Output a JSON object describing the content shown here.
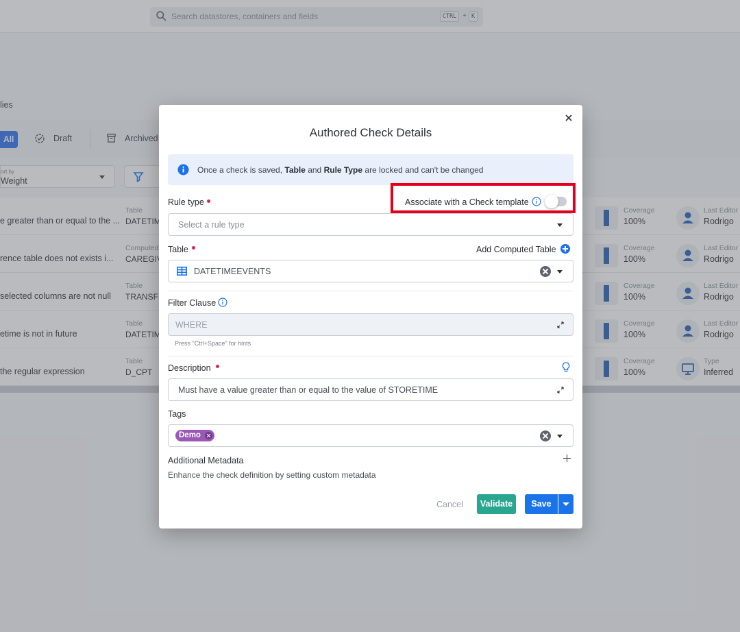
{
  "topbar": {
    "search_placeholder": "Search datastores, containers and fields",
    "shortcut_ctrl": "CTRL",
    "shortcut_plus": "+",
    "shortcut_key": "K"
  },
  "page": {
    "crumb": "lies",
    "tabs": [
      {
        "label": "All"
      },
      {
        "label": "Draft"
      },
      {
        "label": "Archived"
      }
    ],
    "sort_label": "ort by",
    "sort_value": "Weight"
  },
  "rows": [
    {
      "name": "e greater than or equal to the ...",
      "type_label": "Table",
      "type_value": "DATETIM",
      "cov_label": "Coverage",
      "cov_value": "100%",
      "ed_label": "Last Editor",
      "ed_value": "Rodrigo",
      "icon": "user-icon"
    },
    {
      "name": "rence table does not exists i...",
      "type_label": "Computed",
      "type_value": "CAREGIV",
      "cov_label": "Coverage",
      "cov_value": "100%",
      "ed_label": "Last Editor",
      "ed_value": "Rodrigo",
      "icon": "user-icon"
    },
    {
      "name": "selected columns are not null",
      "type_label": "Table",
      "type_value": "TRANSFE",
      "cov_label": "Coverage",
      "cov_value": "100%",
      "ed_label": "Last Editor",
      "ed_value": "Rodrigo",
      "icon": "user-icon"
    },
    {
      "name": "etime is not in future",
      "type_label": "Table",
      "type_value": "DATETIM",
      "cov_label": "Coverage",
      "cov_value": "100%",
      "ed_label": "Last Editor",
      "ed_value": "Rodrigo",
      "icon": "user-icon"
    },
    {
      "name": "the regular expression",
      "type_label": "Table",
      "type_value": "D_CPT",
      "cov_label": "Coverage",
      "cov_value": "100%",
      "ed_label": "Type",
      "ed_value": "Inferred",
      "icon": "monitor-icon"
    }
  ],
  "modal": {
    "title": "Authored Check Details",
    "info_prefix": "Once a check is saved,",
    "info_table": "Table",
    "info_and": "and",
    "info_rule_type": "Rule Type",
    "info_suffix": "are locked and can't be changed",
    "rule_type_label": "Rule type",
    "associate_label": "Associate with a Check template",
    "associate_enabled": false,
    "rule_type_placeholder": "Select a rule type",
    "table_label": "Table",
    "add_computed_label": "Add Computed Table",
    "table_value": "DATETIMEEVENTS",
    "filter_label": "Filter Clause",
    "filter_placeholder": "WHERE",
    "filter_hint": "Press \"Ctrl+Space\" for hints",
    "description_label": "Description",
    "description_value": "Must have a value greater than or equal to the value of STORETIME",
    "tags_label": "Tags",
    "tags": [
      "Demo"
    ],
    "metadata_label": "Additional Metadata",
    "metadata_desc": "Enhance the check definition by setting custom metadata",
    "cancel_label": "Cancel",
    "validate_label": "Validate",
    "save_label": "Save"
  },
  "colors": {
    "primary": "#1a73e8",
    "validate": "#2aa58f",
    "tag": "#9b59b6",
    "required": "#d8245a",
    "highlight": "#e3001b"
  }
}
